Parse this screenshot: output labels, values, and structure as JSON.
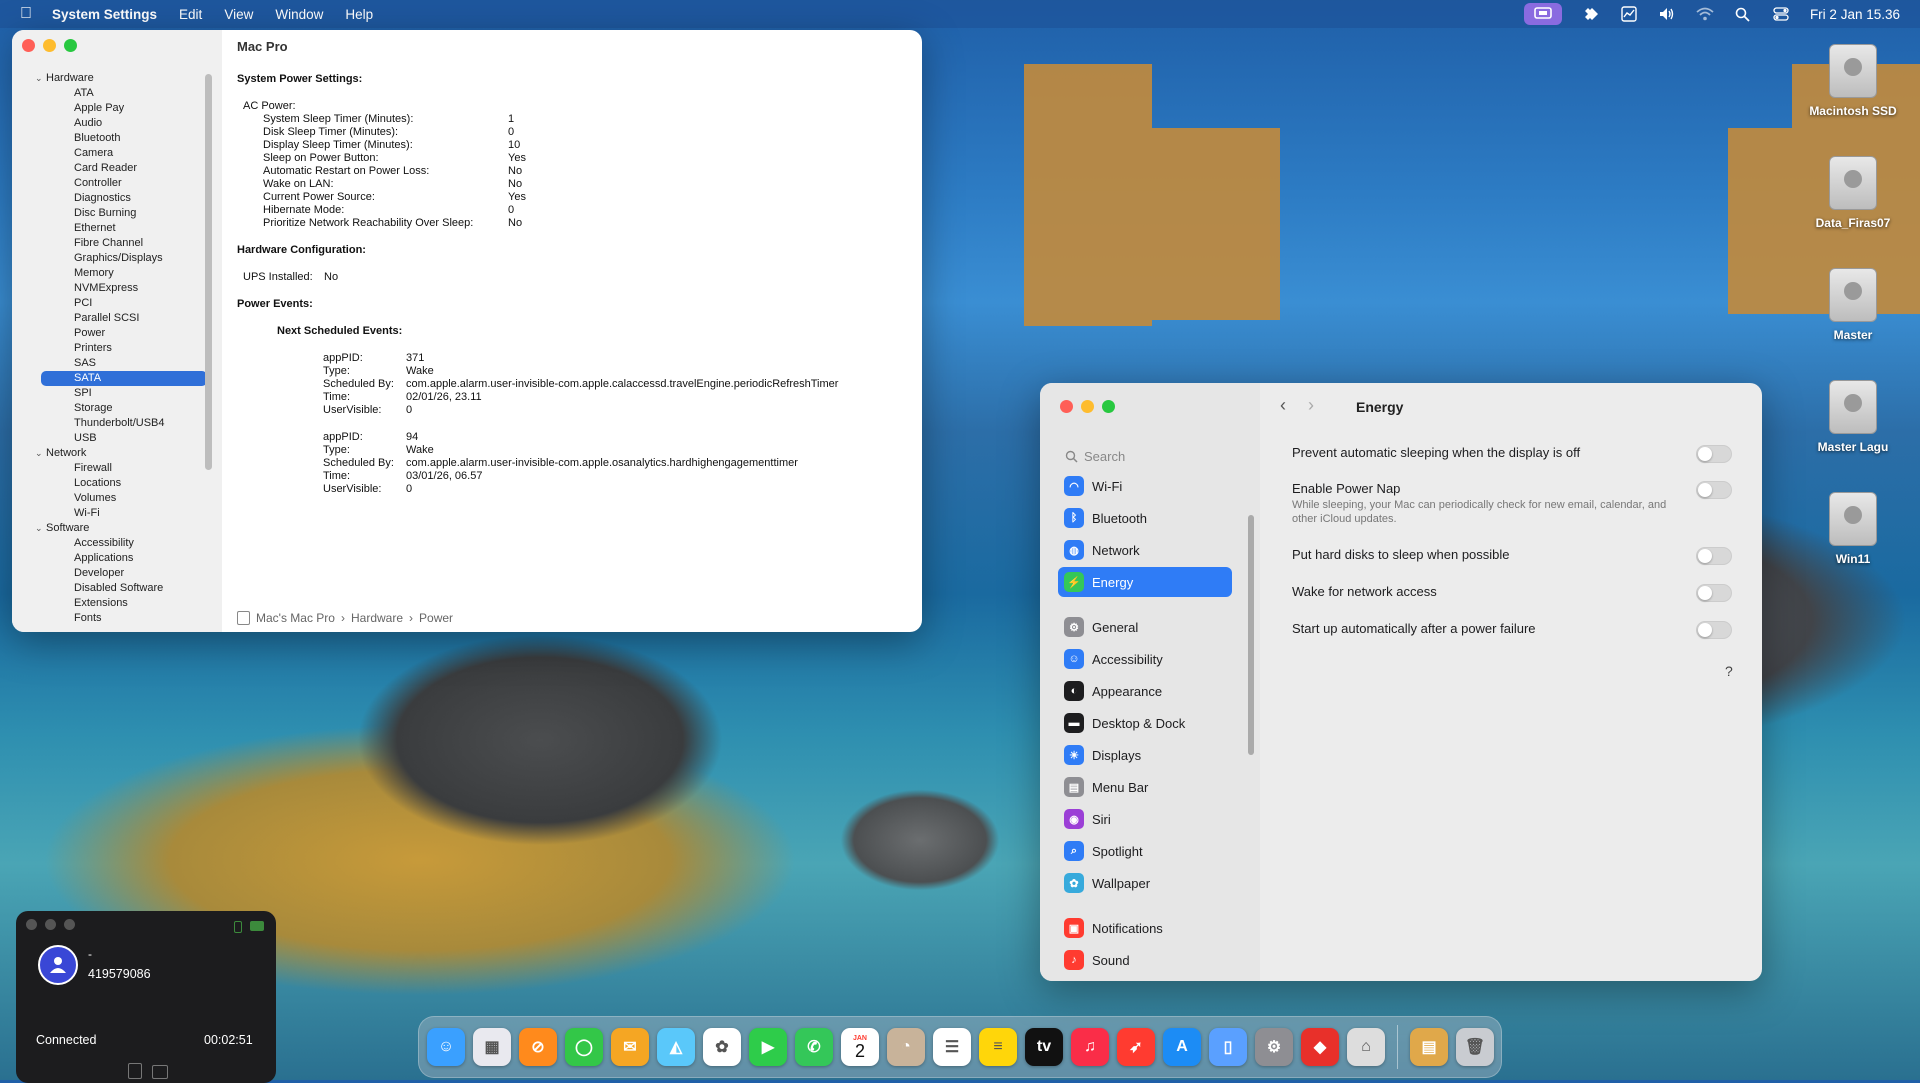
{
  "menubar": {
    "app_name": "System Settings",
    "menus": [
      "Edit",
      "View",
      "Window",
      "Help"
    ],
    "clock": "Fri 2 Jan  15.36"
  },
  "sysinfo": {
    "title": "Mac Pro",
    "tree": [
      {
        "label": "Hardware",
        "level": "group"
      },
      {
        "label": "ATA",
        "level": "child"
      },
      {
        "label": "Apple Pay",
        "level": "child"
      },
      {
        "label": "Audio",
        "level": "child"
      },
      {
        "label": "Bluetooth",
        "level": "child"
      },
      {
        "label": "Camera",
        "level": "child"
      },
      {
        "label": "Card Reader",
        "level": "child"
      },
      {
        "label": "Controller",
        "level": "child"
      },
      {
        "label": "Diagnostics",
        "level": "child"
      },
      {
        "label": "Disc Burning",
        "level": "child"
      },
      {
        "label": "Ethernet",
        "level": "child"
      },
      {
        "label": "Fibre Channel",
        "level": "child"
      },
      {
        "label": "Graphics/Displays",
        "level": "child"
      },
      {
        "label": "Memory",
        "level": "child"
      },
      {
        "label": "NVMExpress",
        "level": "child"
      },
      {
        "label": "PCI",
        "level": "child"
      },
      {
        "label": "Parallel SCSI",
        "level": "child"
      },
      {
        "label": "Power",
        "level": "child"
      },
      {
        "label": "Printers",
        "level": "child"
      },
      {
        "label": "SAS",
        "level": "child"
      },
      {
        "label": "SATA",
        "level": "child",
        "selected": true
      },
      {
        "label": "SPI",
        "level": "child"
      },
      {
        "label": "Storage",
        "level": "child"
      },
      {
        "label": "Thunderbolt/USB4",
        "level": "child"
      },
      {
        "label": "USB",
        "level": "child"
      },
      {
        "label": "Network",
        "level": "group"
      },
      {
        "label": "Firewall",
        "level": "child"
      },
      {
        "label": "Locations",
        "level": "child"
      },
      {
        "label": "Volumes",
        "level": "child"
      },
      {
        "label": "Wi-Fi",
        "level": "child"
      },
      {
        "label": "Software",
        "level": "group"
      },
      {
        "label": "Accessibility",
        "level": "child"
      },
      {
        "label": "Applications",
        "level": "child"
      },
      {
        "label": "Developer",
        "level": "child"
      },
      {
        "label": "Disabled Software",
        "level": "child"
      },
      {
        "label": "Extensions",
        "level": "child"
      },
      {
        "label": "Fonts",
        "level": "child"
      }
    ],
    "system_power_heading": "System Power Settings:",
    "ac_power_label": "AC Power:",
    "ac_settings": [
      {
        "key": "System Sleep Timer (Minutes):",
        "value": "1"
      },
      {
        "key": "Disk Sleep Timer (Minutes):",
        "value": "0"
      },
      {
        "key": "Display Sleep Timer (Minutes):",
        "value": "10"
      },
      {
        "key": "Sleep on Power Button:",
        "value": "Yes"
      },
      {
        "key": "Automatic Restart on Power Loss:",
        "value": "No"
      },
      {
        "key": "Wake on LAN:",
        "value": "No"
      },
      {
        "key": "Current Power Source:",
        "value": "Yes"
      },
      {
        "key": "Hibernate Mode:",
        "value": "0"
      },
      {
        "key": "Prioritize Network Reachability Over Sleep:",
        "value": "No"
      }
    ],
    "hardware_config_heading": "Hardware Configuration:",
    "ups_label": "UPS Installed:",
    "ups_value": "No",
    "power_events_heading": "Power Events:",
    "next_events_heading": "Next Scheduled Events:",
    "events": [
      {
        "rows": [
          {
            "key": "appPID:",
            "value": "371"
          },
          {
            "key": "Type:",
            "value": "Wake"
          },
          {
            "key": "Scheduled By:",
            "value": "com.apple.alarm.user-invisible-com.apple.calaccessd.travelEngine.periodicRefreshTimer"
          },
          {
            "key": "Time:",
            "value": "02/01/26, 23.11"
          },
          {
            "key": "UserVisible:",
            "value": "0"
          }
        ]
      },
      {
        "rows": [
          {
            "key": "appPID:",
            "value": "94"
          },
          {
            "key": "Type:",
            "value": "Wake"
          },
          {
            "key": "Scheduled By:",
            "value": "com.apple.alarm.user-invisible-com.apple.osanalytics.hardhighengagementtimer"
          },
          {
            "key": "Time:",
            "value": "03/01/26, 06.57"
          },
          {
            "key": "UserVisible:",
            "value": "0"
          }
        ]
      }
    ],
    "breadcrumb": [
      "Mac's Mac Pro",
      "Hardware",
      "Power"
    ]
  },
  "energy": {
    "search_placeholder": "Search",
    "pane_title": "Energy",
    "sidebar_items": [
      {
        "label": "Wi-Fi",
        "icon": "wifi-icon",
        "color": "#2f7cf6",
        "glyph": "◠"
      },
      {
        "label": "Bluetooth",
        "icon": "bluetooth-icon",
        "color": "#2f7cf6",
        "glyph": "ᛒ"
      },
      {
        "label": "Network",
        "icon": "globe-icon",
        "color": "#2f7cf6",
        "glyph": "◍"
      },
      {
        "label": "Energy",
        "icon": "bolt-icon",
        "color": "#34c759",
        "glyph": "⚡",
        "active": true
      },
      {
        "label": "General",
        "icon": "gear-icon",
        "color": "#8e8e93",
        "glyph": "⚙"
      },
      {
        "label": "Accessibility",
        "icon": "accessibility-icon",
        "color": "#2f7cf6",
        "glyph": "☺"
      },
      {
        "label": "Appearance",
        "icon": "appearance-icon",
        "color": "#1d1d1f",
        "glyph": "◐"
      },
      {
        "label": "Desktop & Dock",
        "icon": "dock-icon",
        "color": "#1d1d1f",
        "glyph": "▬"
      },
      {
        "label": "Displays",
        "icon": "sun-icon",
        "color": "#2f7cf6",
        "glyph": "☀"
      },
      {
        "label": "Menu Bar",
        "icon": "menubar-icon",
        "color": "#8e8e93",
        "glyph": "▤"
      },
      {
        "label": "Siri",
        "icon": "siri-icon",
        "color": "#9b3fd6",
        "glyph": "◉"
      },
      {
        "label": "Spotlight",
        "icon": "magnifier-icon",
        "color": "#2f7cf6",
        "glyph": "⌕"
      },
      {
        "label": "Wallpaper",
        "icon": "flower-icon",
        "color": "#37aadc",
        "glyph": "✿"
      },
      {
        "label": "Notifications",
        "icon": "bell-icon",
        "color": "#ff3b30",
        "glyph": "▣"
      },
      {
        "label": "Sound",
        "icon": "speaker-icon",
        "color": "#ff3b30",
        "glyph": "♪"
      }
    ],
    "settings": [
      {
        "label": "Prevent automatic sleeping when the display is off",
        "desc": "",
        "on": false
      },
      {
        "label": "Enable Power Nap",
        "desc": "While sleeping, your Mac can periodically check for new email, calendar, and other iCloud updates.",
        "on": false
      },
      {
        "label": "Put hard disks to sleep when possible",
        "desc": "",
        "on": false
      },
      {
        "label": "Wake for network access",
        "desc": "",
        "on": false
      },
      {
        "label": "Start up automatically after a power failure",
        "desc": "",
        "on": false
      }
    ],
    "help": "?"
  },
  "desktop": {
    "icons": [
      "Macintosh SSD",
      "Data_Firas07",
      "Master",
      "Master Lagu",
      "Win11"
    ]
  },
  "call": {
    "name": "-",
    "number": "419579086",
    "status": "Connected",
    "duration": "00:02:51"
  },
  "dock": {
    "calendar_month": "JAN",
    "calendar_day": "2",
    "apps": [
      {
        "name": "finder",
        "color": "#3aa0ff",
        "glyph": "☺"
      },
      {
        "name": "launchpad",
        "color": "#e9e9ef",
        "glyph": "▦"
      },
      {
        "name": "safari",
        "color": "#ff8a1c",
        "glyph": "⊘"
      },
      {
        "name": "messages",
        "color": "#33c748",
        "glyph": "◯"
      },
      {
        "name": "mail-app",
        "color": "#f5a623",
        "glyph": "✉"
      },
      {
        "name": "maps",
        "color": "#5ac8fa",
        "glyph": "◭"
      },
      {
        "name": "photos",
        "color": "#ffffff",
        "glyph": "✿"
      },
      {
        "name": "facetime",
        "color": "#2ecc4a",
        "glyph": "▶"
      },
      {
        "name": "phone",
        "color": "#34c759",
        "glyph": "✆"
      },
      {
        "name": "calendar",
        "color": "#ffffff",
        "glyph": ""
      },
      {
        "name": "contacts",
        "color": "#c8b39a",
        "glyph": "◔"
      },
      {
        "name": "reminders",
        "color": "#ffffff",
        "glyph": "☰"
      },
      {
        "name": "notes",
        "color": "#ffd60a",
        "glyph": "≡"
      },
      {
        "name": "apple-tv",
        "color": "#111111",
        "glyph": "tv"
      },
      {
        "name": "music",
        "color": "#fa2d48",
        "glyph": "♫"
      },
      {
        "name": "rocket-app",
        "color": "#ff3b30",
        "glyph": "➶"
      },
      {
        "name": "app-store",
        "color": "#1c8cf5",
        "glyph": "A"
      },
      {
        "name": "iphone-mirroring",
        "color": "#5aa0ff",
        "glyph": "▯"
      },
      {
        "name": "system-settings",
        "color": "#8e8e93",
        "glyph": "⚙"
      },
      {
        "name": "anydesk",
        "color": "#e8302a",
        "glyph": "◆"
      },
      {
        "name": "archive-utility",
        "color": "#dddddd",
        "glyph": "⌂"
      }
    ],
    "right_items": [
      {
        "name": "downloads-stack",
        "color": "#e0a84a",
        "glyph": "▤"
      },
      {
        "name": "trash",
        "color": "#c9ccd1",
        "glyph": "🗑"
      }
    ]
  }
}
